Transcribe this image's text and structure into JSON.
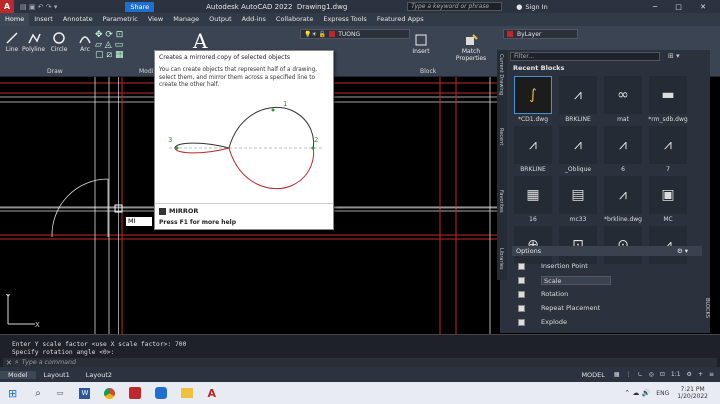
{
  "title_bar": {
    "app_title": "Autodesk AutoCAD 2022",
    "doc_title": "Drawing1.dwg",
    "search_placeholder": "Type a keyword or phrase",
    "sign_in": "Sign In",
    "share": "Share",
    "logo": "A"
  },
  "tabs": [
    "Home",
    "Insert",
    "Annotate",
    "Parametric",
    "View",
    "Manage",
    "Output",
    "Add-ins",
    "Collaborate",
    "Express Tools",
    "Featured Apps"
  ],
  "ribbon": {
    "draw_tools": [
      "Line",
      "Polyline",
      "Circle",
      "Arc"
    ],
    "draw_panel": "Draw",
    "modify_panel": "Modify",
    "block_panel": "Block",
    "insert": "Insert",
    "match_properties": "Match Properties",
    "layer_name": "TUONG",
    "bylayer": "ByLayer"
  },
  "tooltip": {
    "header": "Creates a mirrored copy of selected objects",
    "description": "You can create objects that represent half of a drawing, select them, and mirror them across a specified line to create the other half.",
    "labels": [
      "1",
      "2",
      "3"
    ],
    "command": "MIRROR",
    "help": "Press F1 for more help"
  },
  "canvas": {
    "command_input": "MI"
  },
  "palette": {
    "filter_placeholder": "Filter...",
    "section": "Recent Blocks",
    "side_tabs": [
      "Current Drawing",
      "Recent",
      "Favorites",
      "Libraries"
    ],
    "side_label": "BLOCKS",
    "blocks": [
      "*CD1.dwg",
      "BRKLINE",
      "mat",
      "*rm_sdb.dwg",
      "BRKLINE",
      "_Oblique",
      "6",
      "7",
      "16",
      "mc33",
      "*brkline.dwg",
      "MC",
      "",
      "",
      "",
      ""
    ],
    "options_title": "Options",
    "options": [
      "Insertion Point",
      "Scale",
      "Rotation",
      "Repeat Placement",
      "Explode"
    ],
    "scale_value": "Scale"
  },
  "command_line": {
    "line1": "Enter Y scale factor <use X scale factor>: 700",
    "line2": "Specify rotation angle <0>:",
    "prompt": "Type a command"
  },
  "status_bar": {
    "tabs": [
      "Model",
      "Layout1",
      "Layout2"
    ],
    "mode": "MODEL",
    "scale": "1:1"
  },
  "taskbar": {
    "lang": "ENG",
    "time": "7:21 PM",
    "date": "1/20/2022"
  },
  "colors": {
    "ribbon": "#3b4453",
    "canvas": "#000000",
    "red_line": "#c0272d",
    "accent": "#1f6fd1"
  }
}
